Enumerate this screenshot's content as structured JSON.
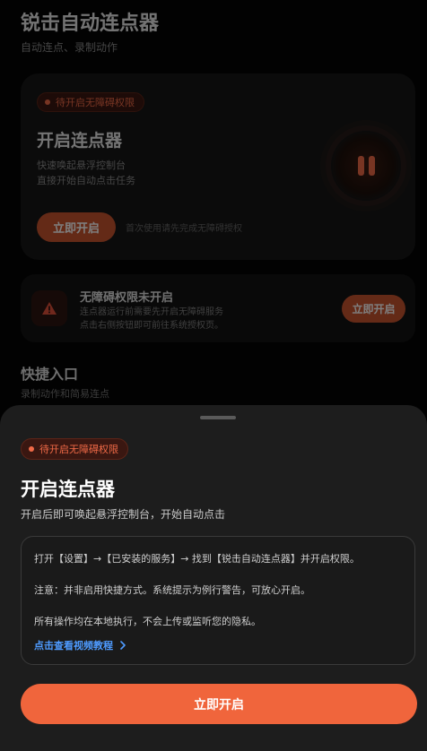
{
  "background": {
    "app_title": "锐击自动连点器",
    "app_subtitle": "自动连点、录制动作",
    "hero_card": {
      "badge": "待开启无障碍权限",
      "title": "开启连点器",
      "desc_line1": "快速唤起悬浮控制台",
      "desc_line2": "直接开始自动点击任务",
      "button_label": "立即开启",
      "hint": "首次使用请先完成无障碍授权"
    },
    "warning_card": {
      "title": "无障碍权限未开启",
      "desc_line1": "连点器运行前需要先开启无障碍服务",
      "desc_line2": "点击右侧按钮即可前往系统授权页。",
      "button_label": "立即开启"
    },
    "quick_section": {
      "title": "快捷入口",
      "subtitle": "录制动作和简易连点"
    }
  },
  "sheet": {
    "badge": "待开启无障碍权限",
    "title": "开启连点器",
    "subtitle": "开启后即可唤起悬浮控制台，开始自动点击",
    "info": {
      "line1": "打开【设置】→【已安装的服务】→ 找到【锐击自动连点器】并开启权限。",
      "line2": "注意：并非启用快捷方式。系统提示为例行警告，可放心开启。",
      "line3": "所有操作均在本地执行，不会上传或监听您的隐私。",
      "tutorial_link": "点击查看视频教程"
    },
    "primary_button": "立即开启"
  },
  "colors": {
    "accent": "#f0653c",
    "badge_text": "#f06a47",
    "link": "#4e9bff",
    "sheet_bg": "#1d1d1d"
  },
  "icons": {
    "hero": "pause-icon",
    "warning": "warning-triangle-icon",
    "link": "chevron-right-icon"
  }
}
